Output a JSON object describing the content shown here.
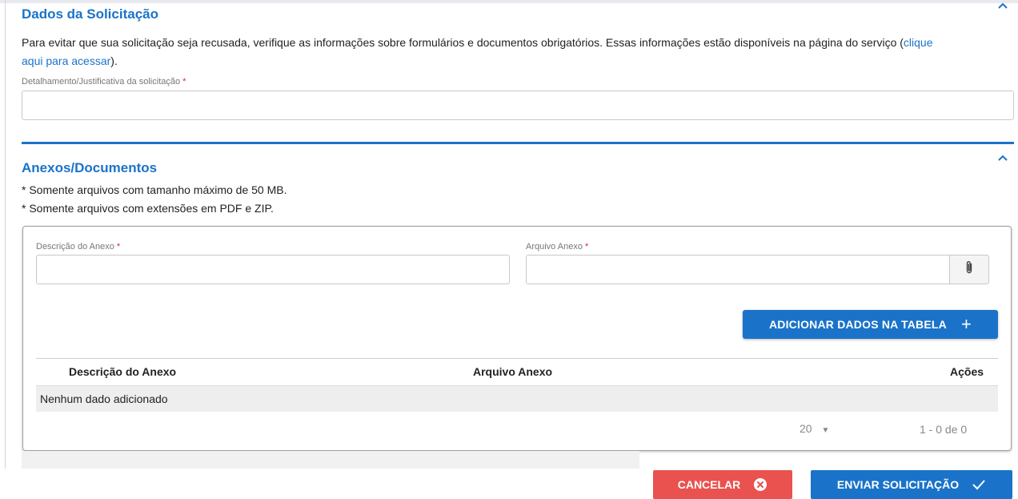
{
  "section_request": {
    "title": "Dados da Solicitação",
    "info_text": "Para evitar que sua solicitação seja recusada, verifique as informações sobre formulários e documentos obrigatórios. Essas informações estão disponíveis na página do serviço (",
    "info_link_part1": "clique",
    "info_link_part2": "aqui para acessar",
    "info_text_end": ").",
    "justification_label": "Detalhamento/Justificativa da solicitação",
    "justification_value": "",
    "required_mark": "*"
  },
  "section_attachments": {
    "title": "Anexos/Documentos",
    "note_size": "* Somente arquivos com tamanho máximo de 50 MB.",
    "note_ext": "* Somente arquivos com extensões em PDF e ZIP.",
    "description_label": "Descrição do Anexo",
    "file_label": "Arquivo Anexo",
    "required_mark": "*",
    "add_button_label": "ADICIONAR DADOS NA TABELA",
    "add_button_icon": "plus-icon",
    "attach_icon": "paperclip-icon",
    "table": {
      "columns": [
        "Descrição do Anexo",
        "Arquivo Anexo",
        "Ações"
      ],
      "empty_text": "Nenhum dado adicionado",
      "page_size": "20",
      "range_text": "1 - 0 de 0"
    }
  },
  "actions": {
    "cancel_label": "CANCELAR",
    "cancel_icon": "close-circle-icon",
    "submit_label": "ENVIAR SOLICITAÇÃO",
    "submit_icon": "check-icon"
  },
  "colors": {
    "accent": "#1a73c9",
    "danger": "#e9524e",
    "required": "#d9262e"
  }
}
